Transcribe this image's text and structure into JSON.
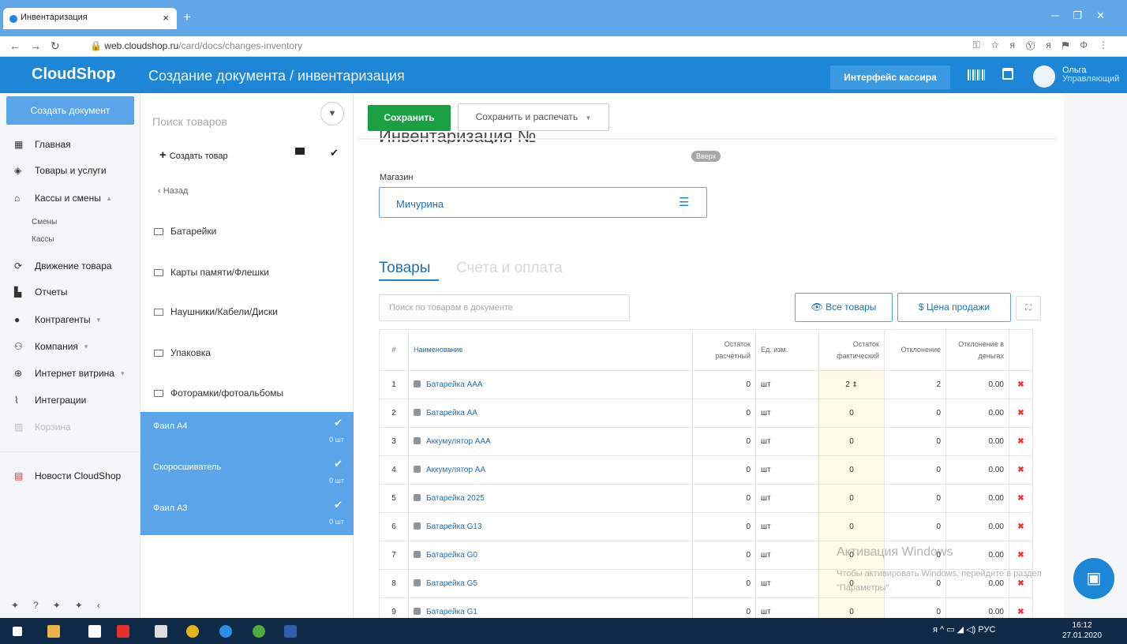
{
  "browser": {
    "tab_title": "Инвентаризация",
    "tab_close": "×",
    "new_tab": "+",
    "url_host": "web.cloudshop.ru",
    "url_path": "/card/docs/changes-inventory"
  },
  "header": {
    "logo": "CloudShop",
    "title": "Создание документа / инвентаризация",
    "cashier_button": "Интерфейс кассира",
    "user_name": "Ольга",
    "user_role": "Управляющий"
  },
  "sidebar": {
    "create_button": "Создать документ",
    "items": [
      {
        "label": "Главная",
        "icon": "grid-icon"
      },
      {
        "label": "Товары и услуги",
        "icon": "box-icon"
      },
      {
        "label": "Кассы и смены",
        "icon": "register-icon"
      },
      {
        "label": "Движение товара",
        "icon": "refresh-icon"
      },
      {
        "label": "Отчеты",
        "icon": "chart-icon"
      },
      {
        "label": "Контрагенты",
        "icon": "person-icon"
      },
      {
        "label": "Компания",
        "icon": "people-icon"
      },
      {
        "label": "Интернет витрина",
        "icon": "globe-icon"
      },
      {
        "label": "Интеграции",
        "icon": "paperclip-icon"
      },
      {
        "label": "Корзина",
        "icon": "trash-icon"
      },
      {
        "label": "Новости CloudShop",
        "icon": "news-icon"
      }
    ],
    "subitems": [
      "Смены",
      "Кассы"
    ]
  },
  "catalog": {
    "search_placeholder": "Поиск товаров",
    "create_product": "Создать товар",
    "back": "Назад",
    "folders": [
      "Батарейки",
      "Карты памяти/Флешки",
      "Наушники/Кабели/Диски",
      "Упаковка",
      "Фоторамки/фотоальбомы"
    ],
    "selected": [
      {
        "name": "Фаил А4",
        "qty": "0 шт"
      },
      {
        "name": "Скоросшиватель",
        "qty": "0 шт"
      },
      {
        "name": "Фаил А3",
        "qty": "0 шт"
      }
    ]
  },
  "main": {
    "save": "Сохранить",
    "save_print": "Сохранить и распечать",
    "doc_title": "Инвентаризация №",
    "up_badge": "Вверх",
    "store_label": "Магазин",
    "store_value": "Мичурина",
    "tab_goods": "Товары",
    "tab_bills": "Счета и оплата",
    "doc_search_placeholder": "Поиск по товарам в документе",
    "all_goods": "Все товары",
    "sale_price": "Цена продажи"
  },
  "table": {
    "headers": [
      "#",
      "Наименование",
      "Остаток расчётный",
      "Ед. изм.",
      "Остаток фактический",
      "Отклонение",
      "Отклонение в деньгах"
    ],
    "rows": [
      [
        "1",
        "Батарейка AAA",
        "0",
        "шт",
        "2",
        "2",
        "0.00"
      ],
      [
        "2",
        "Батарейка AA",
        "0",
        "шт",
        "0",
        "0",
        "0.00"
      ],
      [
        "3",
        "Аккумулятор AAA",
        "0",
        "шт",
        "0",
        "0",
        "0.00"
      ],
      [
        "4",
        "Аккумулятор AA",
        "0",
        "шт",
        "0",
        "0",
        "0.00"
      ],
      [
        "5",
        "Батарейка 2025",
        "0",
        "шт",
        "0",
        "0",
        "0.00"
      ],
      [
        "6",
        "Батарейка G13",
        "0",
        "шт",
        "0",
        "0",
        "0.00"
      ],
      [
        "7",
        "Батарейка G0",
        "0",
        "шт",
        "0",
        "0",
        "0.00"
      ],
      [
        "8",
        "Батарейка G5",
        "0",
        "шт",
        "0",
        "0",
        "0.00"
      ],
      [
        "9",
        "Батарейка G1",
        "0",
        "шт",
        "0",
        "0",
        "0.00"
      ]
    ]
  },
  "watermark": {
    "title": "Активация Windows",
    "text": "Чтобы активировать Windows, перейдите в раздел \"Параметры\"."
  },
  "taskbar": {
    "lang": "РУС",
    "time": "16:12",
    "date": "27.01.2020"
  },
  "colors": {
    "brand": "#1e86d6",
    "save": "#1aa143",
    "selected": "#5aa5ea"
  }
}
